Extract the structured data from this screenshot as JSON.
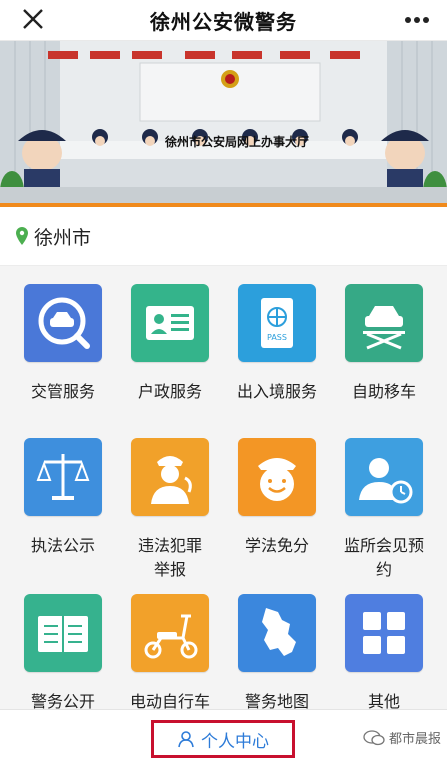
{
  "header": {
    "title": "徐州公安微警务",
    "close_icon": "close-icon",
    "more_icon": "more-icon"
  },
  "banner": {
    "caption": "徐州市公安局网上办事大厅"
  },
  "location": {
    "city": "徐州市",
    "icon": "location-pin-icon",
    "color": "#4caf50"
  },
  "services": [
    {
      "label": "交管服务",
      "icon": "car-search-icon",
      "color": "#4a78d8"
    },
    {
      "label": "户政服务",
      "icon": "id-card-icon",
      "color": "#34b48b"
    },
    {
      "label": "出入境服务",
      "icon": "passport-icon",
      "color": "#2c9fdc"
    },
    {
      "label": "自助移车",
      "icon": "car-lift-icon",
      "color": "#36a986"
    },
    {
      "label": "执法公示",
      "icon": "scales-icon",
      "color": "#3e8fdd"
    },
    {
      "label": "违法犯罪\n举报",
      "icon": "police-report-icon",
      "color": "#f1a12a"
    },
    {
      "label": "学法免分",
      "icon": "smiley-officer-icon",
      "color": "#f39625"
    },
    {
      "label": "监所会见预\n约",
      "icon": "visitor-clock-icon",
      "color": "#3e9fe0"
    },
    {
      "label": "警务公开",
      "icon": "open-book-icon",
      "color": "#36b28e"
    },
    {
      "label": "电动自行车",
      "icon": "scooter-icon",
      "color": "#f2a12a"
    },
    {
      "label": "警务地图",
      "icon": "map-icon",
      "color": "#3b87dd"
    },
    {
      "label": "其他",
      "icon": "grid-apps-icon",
      "color": "#4f7ee0"
    }
  ],
  "footer": {
    "center_label": "个人中心",
    "watermark": "都市晨报",
    "user_icon": "user-icon",
    "highlight_color": "#c8102e"
  }
}
